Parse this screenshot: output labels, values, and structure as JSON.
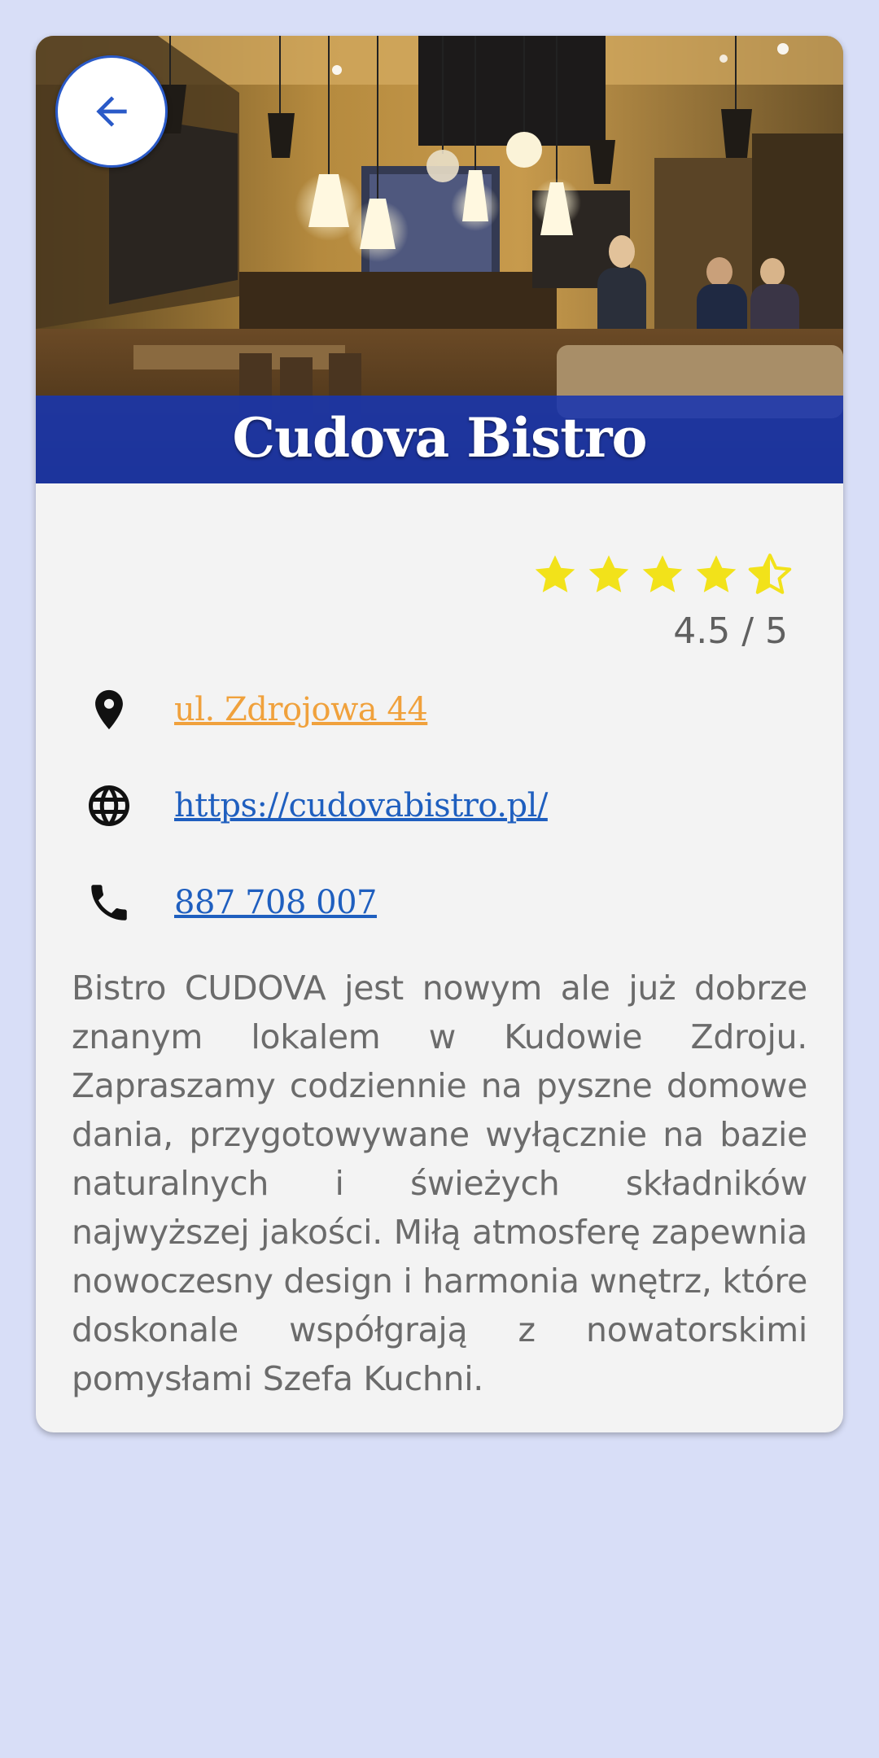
{
  "restaurant": {
    "name": "Cudova Bistro",
    "rating": {
      "value": 4.5,
      "max": 5,
      "label": "4.5 / 5"
    },
    "address": "ul. Zdrojowa 44",
    "website": "https://cudovabistro.pl/",
    "phone": "887 708 007",
    "description": "Bistro CUDOVA jest nowym ale już dobrze znanym lokalem w Kudowie Zdroju. Zapraszamy codziennie na pyszne domowe dania, przygotowywane wyłącznie na bazie naturalnych i świeżych składników najwyższej jakości. Miłą atmosferę zapewnia nowoczesny design i harmonia wnętrz, które doskonale współgrają z nowatorskimi pomysłami Szefa Kuchni."
  },
  "icons": {
    "back": "arrow-back-icon",
    "address": "location-pin-icon",
    "website": "globe-icon",
    "phone": "phone-icon",
    "star_full": "star-icon",
    "star_half": "star-half-icon"
  },
  "colors": {
    "background": "#d8def7",
    "card": "#f3f3f3",
    "title_band": "#1836af",
    "star": "#f2e21a",
    "address_link": "#f0a13c",
    "link": "#1f5fbf",
    "back_button_border": "#2a5ac8",
    "description_text": "#6b6b6b"
  }
}
